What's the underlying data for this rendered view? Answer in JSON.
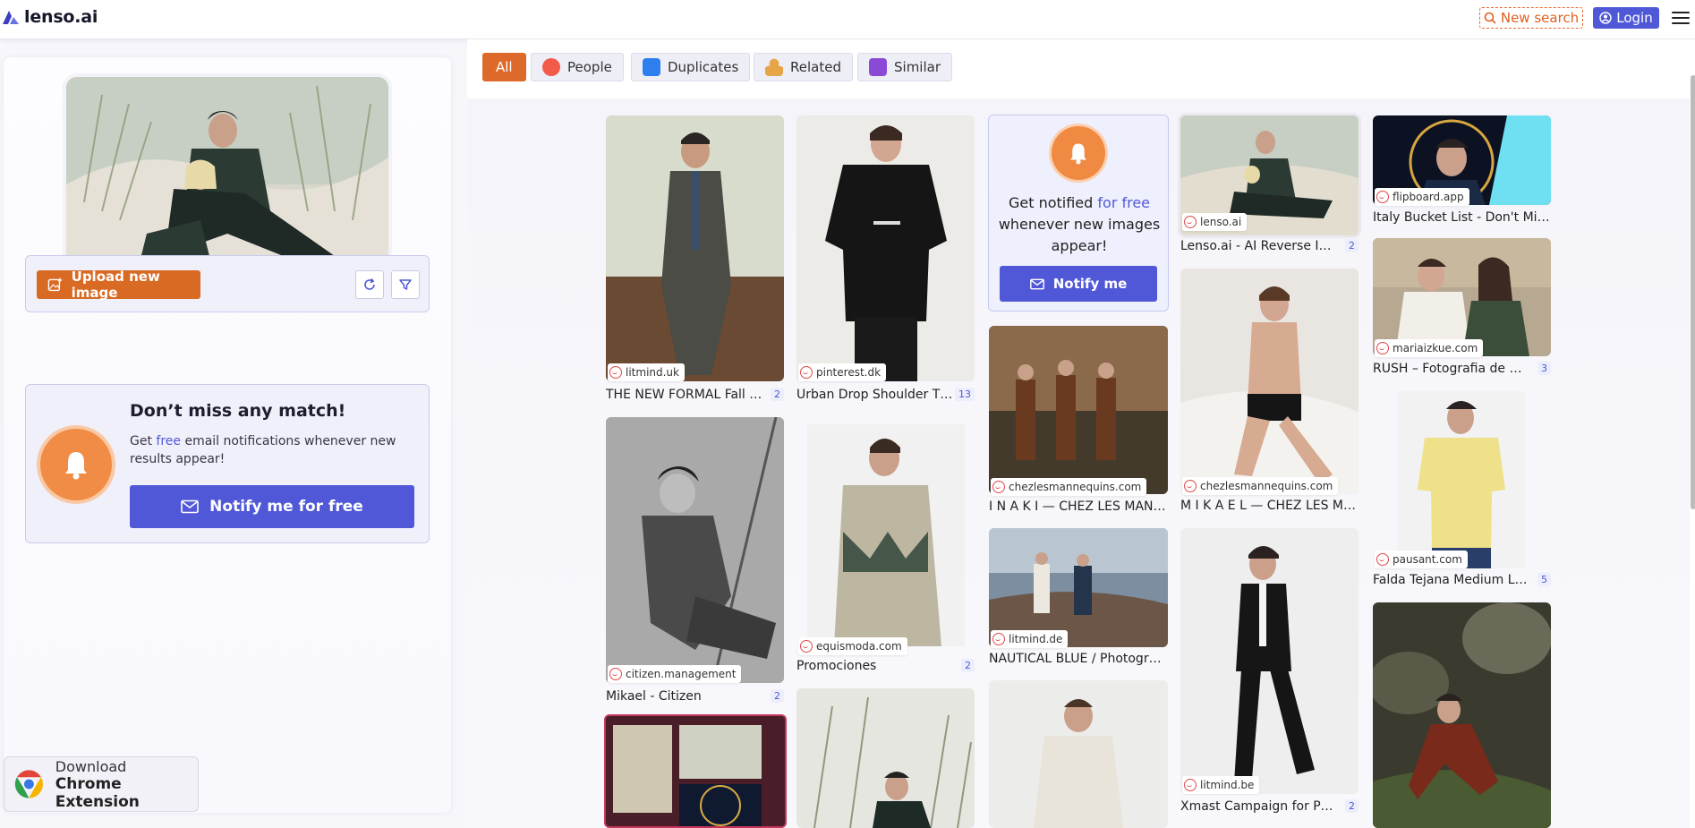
{
  "header": {
    "logo_text": "lenso.ai",
    "new_search_label": "New search",
    "login_label": "Login"
  },
  "left": {
    "upload_label": "Upload new image",
    "notify": {
      "title": "Don’t miss any match!",
      "text_before": "Get ",
      "text_free": "free",
      "text_after": " email notifications whenever new results appear!",
      "button_label": "Notify me for free"
    },
    "extension": {
      "line1": "Download",
      "line2": "Chrome Extension"
    }
  },
  "filters": [
    {
      "label": "All",
      "icon": "all"
    },
    {
      "label": "People",
      "icon": "people-icon"
    },
    {
      "label": "Duplicates",
      "icon": "duplicates-icon"
    },
    {
      "label": "Related",
      "icon": "related-icon"
    },
    {
      "label": "Similar",
      "icon": "similar-icon"
    }
  ],
  "promo": {
    "line1": "Get notified ",
    "free": "for free",
    "line2": " whenever new images appear!",
    "button_label": "Notify me"
  },
  "results": [
    {
      "source": "litmind.uk",
      "title": "THE NEW FORMAL Fall Wi...",
      "count": "2"
    },
    {
      "source": "pinterest.dk",
      "title": "Urban Drop Shoulder T S...",
      "count": "13"
    },
    {
      "source": "lenso.ai",
      "title": "Lenso.ai - AI Reverse Ima...",
      "count": "2"
    },
    {
      "source": "flipboard.app",
      "title": "Italy Bucket List - Don't Miss ...",
      "count": ""
    },
    {
      "source": "mariaizkue.com",
      "title": "RUSH – Fotografia de bod...",
      "count": "3"
    },
    {
      "source": "chezlesmannequins.com",
      "title": "I N A K I — CHEZ LES MANNE...",
      "count": ""
    },
    {
      "source": "chezlesmannequins.com",
      "title": "M I K A E L — CHEZ LES MAN...",
      "count": ""
    },
    {
      "source": "citizen.management",
      "title": "Mikael - Citizen",
      "count": "2"
    },
    {
      "source": "equismoda.com",
      "title": "Promociones",
      "count": "2"
    },
    {
      "source": "pausant.com",
      "title": "Falda Tejana Medium Lig...",
      "count": "5"
    },
    {
      "source": "litmind.de",
      "title": "NAUTICAL BLUE / Photograp...",
      "count": ""
    },
    {
      "source": "litmind.be",
      "title": "Xmast Campaign for Puro...",
      "count": "2"
    }
  ],
  "colors": {
    "accent": "#dd6a2a",
    "primary": "#5058d8",
    "bell": "#f08c45"
  }
}
